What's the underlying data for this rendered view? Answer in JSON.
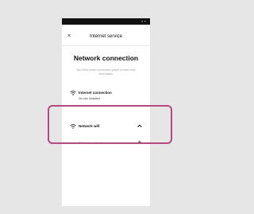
{
  "header": {
    "close_icon": "close-icon",
    "close_symbol": "×",
    "title": "Internet service"
  },
  "status_bar": {
    "indicators": "▪ ▪"
  },
  "main": {
    "title": "Network connection",
    "description": "You'll find which connection youre on and more information"
  },
  "internet_connection": {
    "icon": "wifi-icon",
    "title": "Internet connection",
    "status": "No sim installed"
  },
  "network_wifi": {
    "icon": "wifi-icon",
    "title": "Network wifi",
    "expanded": true,
    "add_label": "Add new network",
    "add_symbol": "+"
  },
  "colors": {
    "background": "#e6e6e6",
    "status_bar": "#121212",
    "highlight": "#b34a80"
  }
}
